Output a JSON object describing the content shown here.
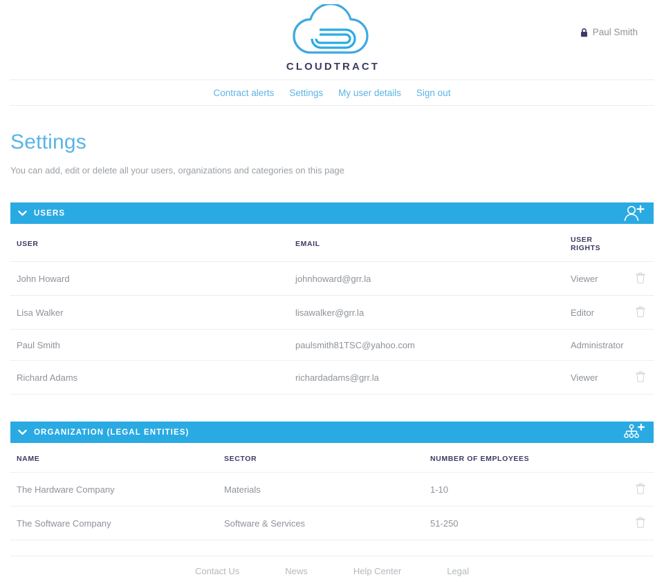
{
  "header": {
    "logo_text": "CLOUDTRACT",
    "logo_icon": "cloud-paperclip-logo",
    "user_name": "Paul Smith",
    "user_icon": "lock-icon"
  },
  "nav": {
    "items": [
      {
        "label": "Contract alerts"
      },
      {
        "label": "Settings"
      },
      {
        "label": "My user details"
      },
      {
        "label": "Sign out"
      }
    ]
  },
  "page": {
    "title": "Settings",
    "subtitle": "You can add, edit or delete all your users, organizations and categories on this page"
  },
  "sections": [
    {
      "id": "users",
      "title": "USERS",
      "collapse_icon": "chevron-down-icon",
      "action_icon": "add-user-icon",
      "columns": [
        "USER",
        "EMAIL",
        "USER RIGHTS"
      ],
      "rows": [
        {
          "user": "John Howard",
          "email": "johnhoward@grr.la",
          "rights": "Viewer",
          "deletable": true
        },
        {
          "user": "Lisa Walker",
          "email": "lisawalker@grr.la",
          "rights": "Editor",
          "deletable": true
        },
        {
          "user": "Paul Smith",
          "email": "paulsmith81TSC@yahoo.com",
          "rights": "Administrator",
          "deletable": false
        },
        {
          "user": "Richard Adams",
          "email": "richardadams@grr.la",
          "rights": "Viewer",
          "deletable": true
        }
      ]
    },
    {
      "id": "organization",
      "title": "ORGANIZATION (LEGAL ENTITIES)",
      "collapse_icon": "chevron-down-icon",
      "action_icon": "add-organization-icon",
      "columns": [
        "NAME",
        "SECTOR",
        "NUMBER OF EMPLOYEES"
      ],
      "rows": [
        {
          "name": "The Hardware Company",
          "sector": "Materials",
          "employees": "1-10",
          "deletable": true
        },
        {
          "name": "The Software Company",
          "sector": "Software & Services",
          "employees": "51-250",
          "deletable": true
        }
      ]
    }
  ],
  "footer": {
    "items": [
      {
        "label": "Contact Us"
      },
      {
        "label": "News"
      },
      {
        "label": "Help Center"
      },
      {
        "label": "Legal"
      }
    ]
  },
  "colors": {
    "brand_blue": "#2aaae2",
    "link_blue": "#5bb4e5",
    "title_blue": "#5bb4e5",
    "text_gray": "#8d9299",
    "header_navy": "#3b3b63",
    "divider": "#eceef0",
    "footer_link": "#b3b8bd"
  }
}
